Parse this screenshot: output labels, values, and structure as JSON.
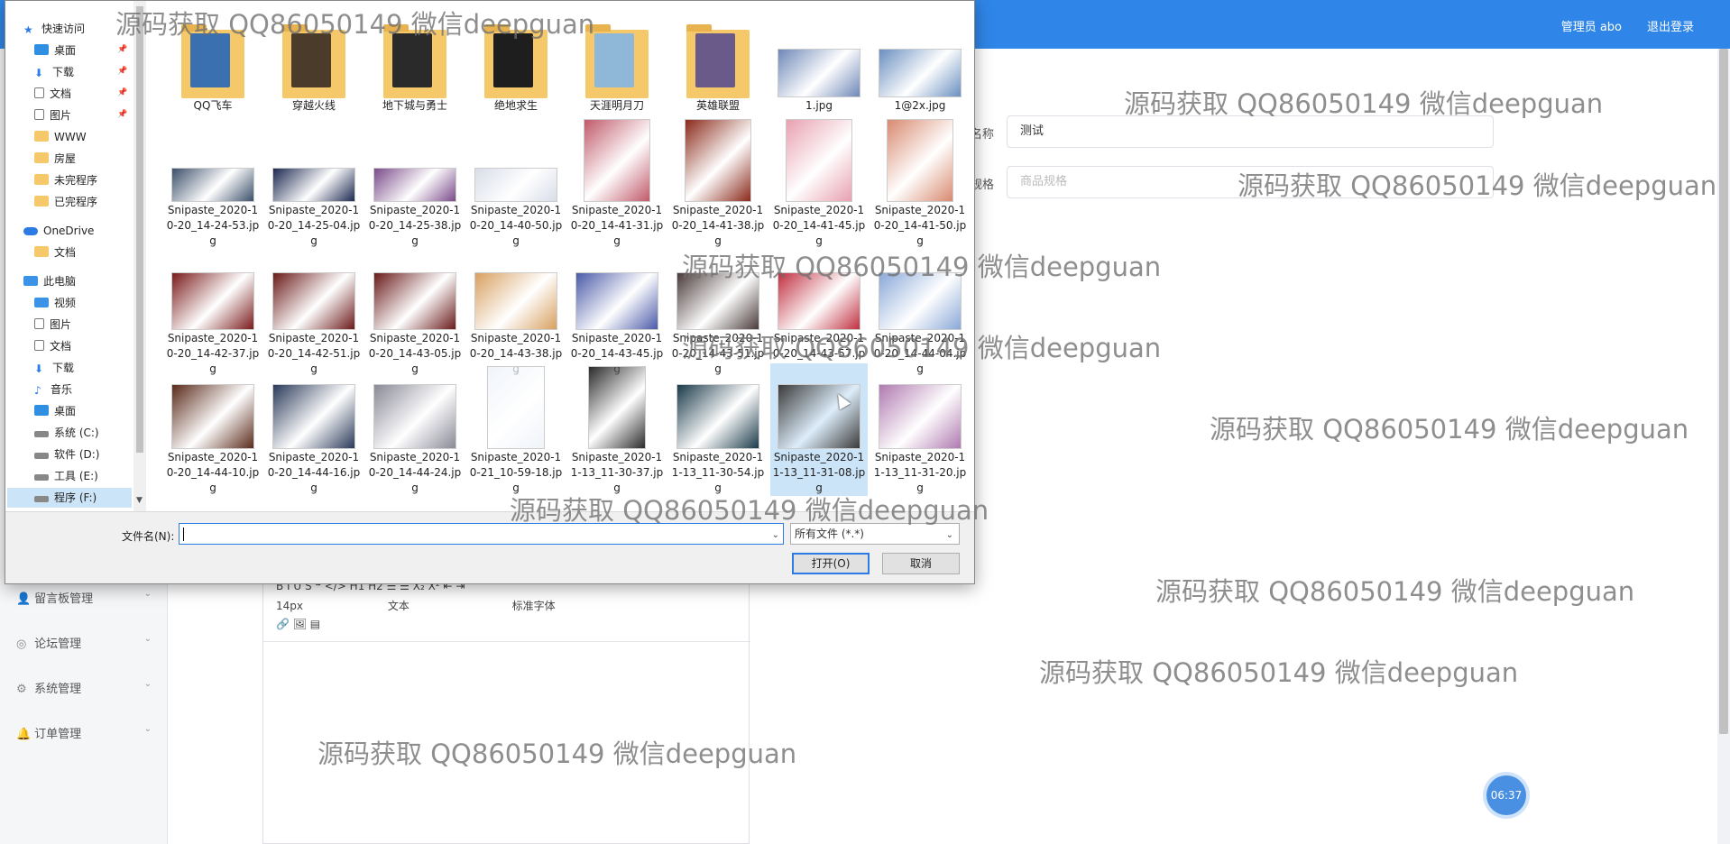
{
  "colors": {
    "topbar": "#2f86e8",
    "accent": "#2c7be5",
    "selection": "#cce4f7"
  },
  "header": {
    "user": "管理员 abo",
    "logout": "退出登录"
  },
  "sidebar": {
    "items": [
      {
        "label": "留言板管理",
        "icon": "user-icon"
      },
      {
        "label": "论坛管理",
        "icon": "compass-icon"
      },
      {
        "label": "系统管理",
        "icon": "settings-icon"
      },
      {
        "label": "订单管理",
        "icon": "bell-icon"
      }
    ]
  },
  "form": {
    "name_label": "名称",
    "name_value": "测试",
    "spec_label": "规格",
    "spec_placeholder": "商品规格"
  },
  "editor": {
    "row1": "B  I  U  S    ❝  </>   H1  H2   ☰  ☰   X₂  X²   ⇤  ⇥",
    "font_size": "14px",
    "text_style": "文本",
    "font_family": "标准字体",
    "row3": "🔗  🖼  ▤"
  },
  "clock": "06:37",
  "dialog": {
    "nav": [
      {
        "label": "快速访问",
        "icon": "star-icon",
        "kind": "top",
        "pinned": false
      },
      {
        "label": "桌面",
        "icon": "desktop-icon",
        "kind": "sub",
        "pinned": true
      },
      {
        "label": "下载",
        "icon": "download-icon",
        "kind": "sub",
        "pinned": true
      },
      {
        "label": "文档",
        "icon": "document-icon",
        "kind": "sub",
        "pinned": true
      },
      {
        "label": "图片",
        "icon": "pictures-icon",
        "kind": "sub",
        "pinned": true
      },
      {
        "label": "WWW",
        "icon": "folder-icon",
        "kind": "sub",
        "pinned": false
      },
      {
        "label": "房屋",
        "icon": "folder-icon",
        "kind": "sub",
        "pinned": false
      },
      {
        "label": "未完程序",
        "icon": "folder-icon",
        "kind": "sub",
        "pinned": false
      },
      {
        "label": "已完程序",
        "icon": "folder-icon",
        "kind": "sub",
        "pinned": false
      },
      {
        "label": "OneDrive",
        "icon": "cloud-icon",
        "kind": "top",
        "pinned": false
      },
      {
        "label": "文档",
        "icon": "folder-icon",
        "kind": "sub",
        "pinned": false
      },
      {
        "label": "此电脑",
        "icon": "computer-icon",
        "kind": "top",
        "pinned": false
      },
      {
        "label": "视频",
        "icon": "video-icon",
        "kind": "sub",
        "pinned": false
      },
      {
        "label": "图片",
        "icon": "pictures-icon",
        "kind": "sub",
        "pinned": false
      },
      {
        "label": "文档",
        "icon": "document-icon",
        "kind": "sub",
        "pinned": false
      },
      {
        "label": "下载",
        "icon": "download-icon",
        "kind": "sub",
        "pinned": false
      },
      {
        "label": "音乐",
        "icon": "music-icon",
        "kind": "sub",
        "pinned": false
      },
      {
        "label": "桌面",
        "icon": "desktop-icon",
        "kind": "sub",
        "pinned": false
      },
      {
        "label": "系统 (C:)",
        "icon": "drive-icon",
        "kind": "sub",
        "pinned": false
      },
      {
        "label": "软件 (D:)",
        "icon": "drive-icon",
        "kind": "sub",
        "pinned": false
      },
      {
        "label": "工具 (E:)",
        "icon": "drive-icon",
        "kind": "sub",
        "pinned": false
      },
      {
        "label": "程序 (F:)",
        "icon": "drive-icon",
        "kind": "sub",
        "pinned": false,
        "selected": true
      }
    ],
    "files": [
      {
        "name": "QQ飞车",
        "type": "folder",
        "color": "#3a6fb0"
      },
      {
        "name": "穿越火线",
        "type": "folder",
        "color": "#4a3b2a"
      },
      {
        "name": "地下城与勇士",
        "type": "folder",
        "color": "#2a2a2a"
      },
      {
        "name": "绝地求生",
        "type": "folder",
        "color": "#1e1e1e"
      },
      {
        "name": "天涯明月刀",
        "type": "folder",
        "color": "#8fb8d8"
      },
      {
        "name": "英雄联盟",
        "type": "folder",
        "color": "#6a5a8a"
      },
      {
        "name": "1.jpg",
        "type": "image",
        "color": "#6f88b8"
      },
      {
        "name": "1@2x.jpg",
        "type": "image",
        "color": "#6a8fc0"
      },
      {
        "name": "Snipaste_2020-10-20_14-24-53.jpg",
        "type": "image",
        "color": "#3b4f6a"
      },
      {
        "name": "Snipaste_2020-10-20_14-25-04.jpg",
        "type": "image",
        "color": "#1b2850"
      },
      {
        "name": "Snipaste_2020-10-20_14-25-38.jpg",
        "type": "image",
        "color": "#7a4a8a"
      },
      {
        "name": "Snipaste_2020-10-20_14-40-50.jpg",
        "type": "image",
        "color": "#d8dde8"
      },
      {
        "name": "Snipaste_2020-10-20_14-41-31.jpg",
        "type": "image",
        "color": "#c05a6a"
      },
      {
        "name": "Snipaste_2020-10-20_14-41-38.jpg",
        "type": "image",
        "color": "#8a2a1a"
      },
      {
        "name": "Snipaste_2020-10-20_14-41-45.jpg",
        "type": "image",
        "color": "#e8a0b0"
      },
      {
        "name": "Snipaste_2020-10-20_14-41-50.jpg",
        "type": "image",
        "color": "#d88a70"
      },
      {
        "name": "Snipaste_2020-10-20_14-42-37.jpg",
        "type": "image",
        "color": "#7a1a1a"
      },
      {
        "name": "Snipaste_2020-10-20_14-42-51.jpg",
        "type": "image",
        "color": "#6a1a18"
      },
      {
        "name": "Snipaste_2020-10-20_14-43-05.jpg",
        "type": "image",
        "color": "#6a1a1a"
      },
      {
        "name": "Snipaste_2020-10-20_14-43-38.jpg",
        "type": "image",
        "color": "#d8a060"
      },
      {
        "name": "Snipaste_2020-10-20_14-43-45.jpg",
        "type": "image",
        "color": "#4a5aa8"
      },
      {
        "name": "Snipaste_2020-10-20_14-43-51.jpg",
        "type": "image",
        "color": "#4a3a3a"
      },
      {
        "name": "Snipaste_2020-10-20_14-43-57.jpg",
        "type": "image",
        "color": "#c03040"
      },
      {
        "name": "Snipaste_2020-10-20_14-44-04.jpg",
        "type": "image",
        "color": "#8aa8d8"
      },
      {
        "name": "Snipaste_2020-10-20_14-44-10.jpg",
        "type": "image",
        "color": "#5a2a1a"
      },
      {
        "name": "Snipaste_2020-10-20_14-44-16.jpg",
        "type": "image",
        "color": "#2a3a5a"
      },
      {
        "name": "Snipaste_2020-10-20_14-44-24.jpg",
        "type": "image",
        "color": "#8a8a98"
      },
      {
        "name": "Snipaste_2020-10-21_10-59-18.jpg",
        "type": "image",
        "color": "#f0f4fa"
      },
      {
        "name": "Snipaste_2020-11-13_11-30-37.jpg",
        "type": "image",
        "color": "#2a2a2a"
      },
      {
        "name": "Snipaste_2020-11-13_11-30-54.jpg",
        "type": "image",
        "color": "#1a3a4a"
      },
      {
        "name": "Snipaste_2020-11-13_11-31-08.jpg",
        "type": "image",
        "color": "#3a3a3a",
        "selected": true
      },
      {
        "name": "Snipaste_2020-11-13_11-31-20.jpg",
        "type": "image",
        "color": "#b07ab0"
      }
    ],
    "filename_label": "文件名(N):",
    "filename_value": "",
    "filetype": "所有文件 (*.*)",
    "open_button": "打开(O)",
    "cancel_button": "取消"
  },
  "watermark_text": "源码获取 QQ86050149 微信deepguan"
}
